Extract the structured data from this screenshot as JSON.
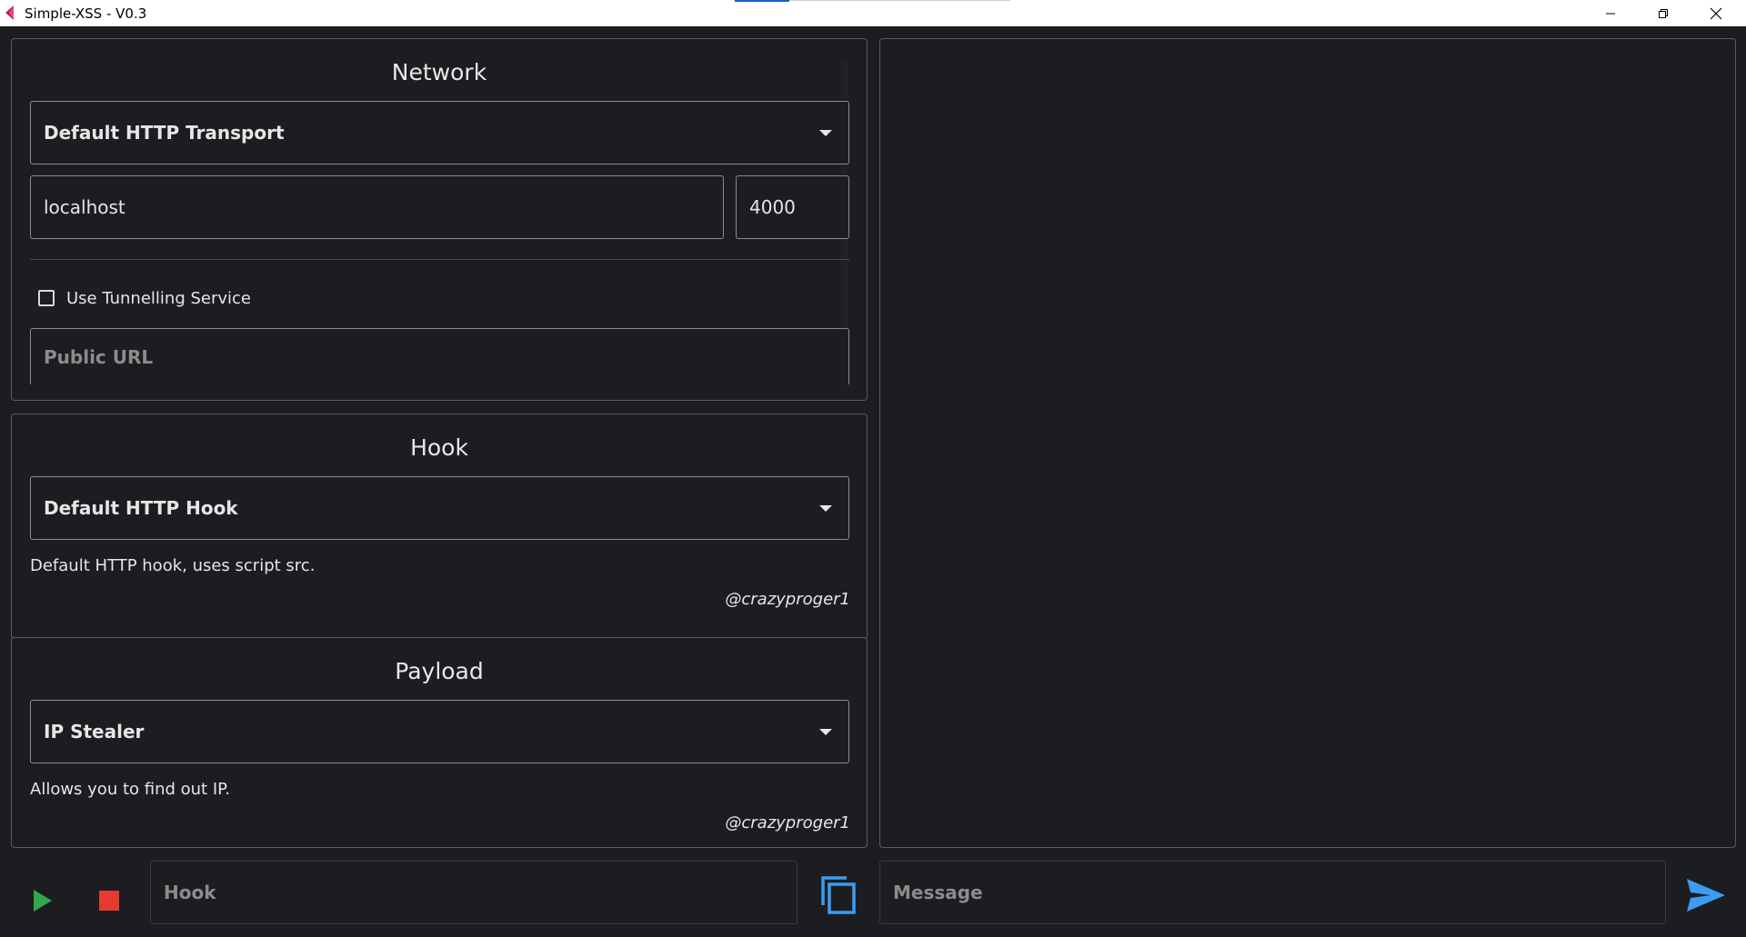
{
  "window": {
    "title": "Simple-XSS - V0.3"
  },
  "network": {
    "title": "Network",
    "transport_selected": "Default HTTP Transport",
    "host_value": "localhost",
    "port_value": "4000",
    "tunnel_label": "Use Tunnelling Service",
    "tunnel_checked": false,
    "public_url_placeholder": "Public URL"
  },
  "hook": {
    "title": "Hook",
    "selected": "Default HTTP Hook",
    "description": "Default HTTP hook, uses script src.",
    "author": "@crazyproger1"
  },
  "payload": {
    "title": "Payload",
    "selected": "IP Stealer",
    "description": "Allows you to find out IP.",
    "author": "@crazyproger1"
  },
  "bottom": {
    "hook_placeholder": "Hook",
    "message_placeholder": "Message"
  },
  "colors": {
    "background": "#1c1d20",
    "play": "#2fa84f",
    "stop": "#e33b2e",
    "accent": "#3b9cf0"
  }
}
